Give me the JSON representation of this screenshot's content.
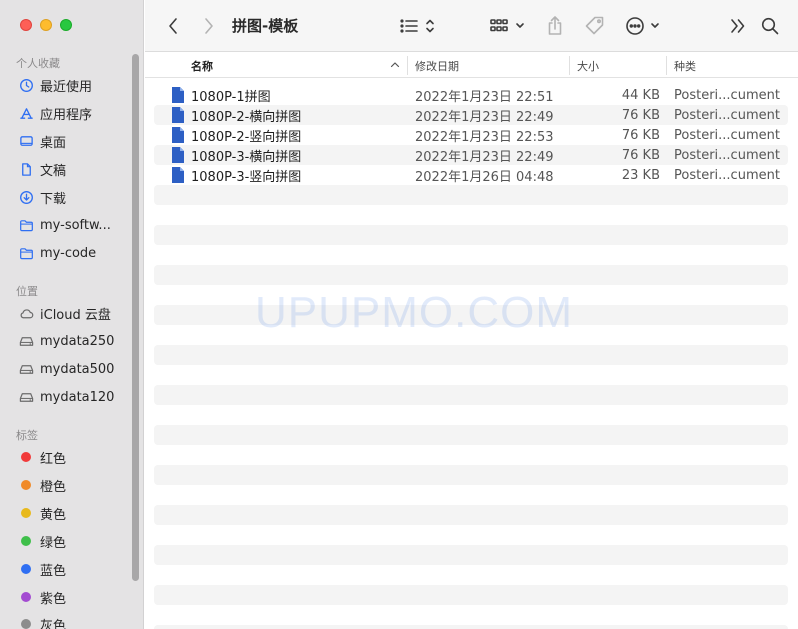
{
  "window": {
    "title": "拼图-模板"
  },
  "sidebar": {
    "favorites_title": "个人收藏",
    "favorites": [
      {
        "label": "最近使用",
        "icon": "clock-icon"
      },
      {
        "label": "应用程序",
        "icon": "apps-icon"
      },
      {
        "label": "桌面",
        "icon": "desktop-icon"
      },
      {
        "label": "文稿",
        "icon": "document-icon"
      },
      {
        "label": "下载",
        "icon": "download-icon"
      },
      {
        "label": "my-softw...",
        "icon": "folder-icon"
      },
      {
        "label": "my-code",
        "icon": "folder-icon"
      }
    ],
    "locations_title": "位置",
    "locations": [
      {
        "label": "iCloud 云盘",
        "icon": "cloud-icon"
      },
      {
        "label": "mydata250",
        "icon": "drive-icon"
      },
      {
        "label": "mydata500",
        "icon": "drive-icon"
      },
      {
        "label": "mydata120",
        "icon": "drive-icon"
      }
    ],
    "tags_title": "标签",
    "tags": [
      {
        "label": "红色",
        "color": "#f13a3a"
      },
      {
        "label": "橙色",
        "color": "#f08a28"
      },
      {
        "label": "黄色",
        "color": "#e8b91c"
      },
      {
        "label": "绿色",
        "color": "#3fbf4a"
      },
      {
        "label": "蓝色",
        "color": "#2f6ff2"
      },
      {
        "label": "紫色",
        "color": "#a34bd1"
      },
      {
        "label": "灰色",
        "color": "#8c8c8c"
      }
    ]
  },
  "columns": {
    "name": "名称",
    "date": "修改日期",
    "size": "大小",
    "kind": "种类"
  },
  "files": [
    {
      "name": "1080P-1拼图",
      "date": "2022年1月23日 22:51",
      "size": "44 KB",
      "kind": "Posteri...cument"
    },
    {
      "name": "1080P-2-横向拼图",
      "date": "2022年1月23日 22:49",
      "size": "76 KB",
      "kind": "Posteri...cument"
    },
    {
      "name": "1080P-2-竖向拼图",
      "date": "2022年1月23日 22:53",
      "size": "76 KB",
      "kind": "Posteri...cument"
    },
    {
      "name": "1080P-3-横向拼图",
      "date": "2022年1月23日 22:49",
      "size": "76 KB",
      "kind": "Posteri...cument"
    },
    {
      "name": "1080P-3-竖向拼图",
      "date": "2022年1月26日 04:48",
      "size": "23 KB",
      "kind": "Posteri...cument"
    }
  ],
  "watermark": "UPUPMO.COM",
  "colors": {
    "sidebar_bg": "#e4e3e4",
    "accent": "#2f6ff2",
    "doc_icon": "#2d5fc4"
  }
}
